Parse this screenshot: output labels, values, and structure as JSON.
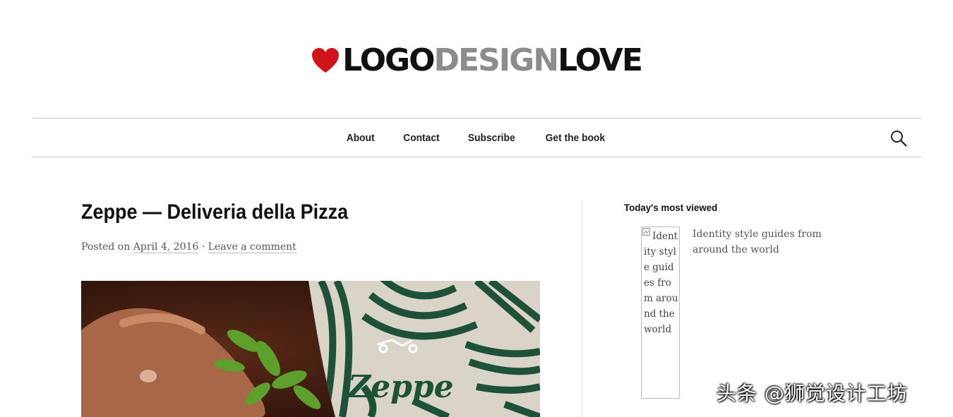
{
  "site": {
    "logo": {
      "part1": "LOGO",
      "part2": "DESIGN",
      "part3": "LOVE",
      "heart_color": "#d0121b",
      "gray_color": "#8c8c8c"
    }
  },
  "nav": {
    "items": [
      {
        "label": "About"
      },
      {
        "label": "Contact"
      },
      {
        "label": "Subscribe"
      },
      {
        "label": "Get the book"
      }
    ],
    "search_icon": "search-icon"
  },
  "post": {
    "title": "Zeppe — Deliveria della Pizza",
    "meta": {
      "posted_on": "Posted on",
      "date": "April 4, 2016",
      "separator": "·",
      "comment_link": "Leave a comment"
    },
    "hero": {
      "brand_text": "Zeppe",
      "apron_color": "#1d5238"
    }
  },
  "sidebar": {
    "title": "Today's most viewed",
    "items": [
      {
        "thumb_alt": "Identity style guides from around the world",
        "label": "Identity style guides from around the world"
      }
    ]
  },
  "watermark": {
    "text": "头条 @狮觉设计工坊"
  }
}
